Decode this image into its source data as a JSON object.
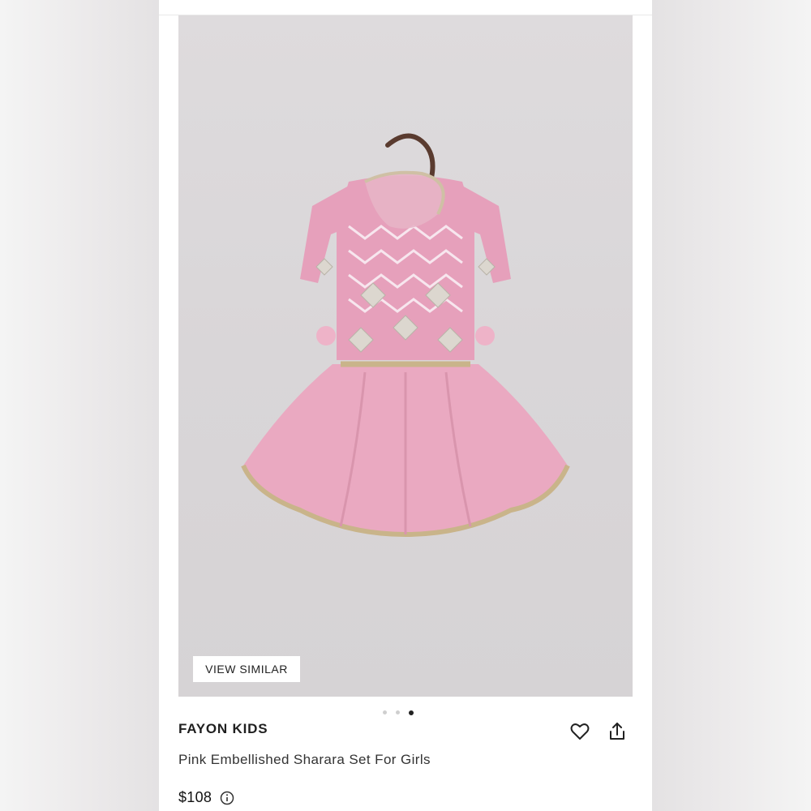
{
  "product": {
    "brand": "FAYON KIDS",
    "title": "Pink Embellished Sharara Set For Girls",
    "price": "$108"
  },
  "gallery": {
    "view_similar_label": "VIEW SIMILAR",
    "dot_count": 3,
    "active_index": 2
  },
  "icons": {
    "wishlist": "heart-icon",
    "share": "share-icon",
    "info": "info-icon"
  },
  "colors": {
    "accent_text": "#1f1f1f",
    "garment_pink": "#e8a9bf",
    "image_background": "#dbd8da"
  }
}
